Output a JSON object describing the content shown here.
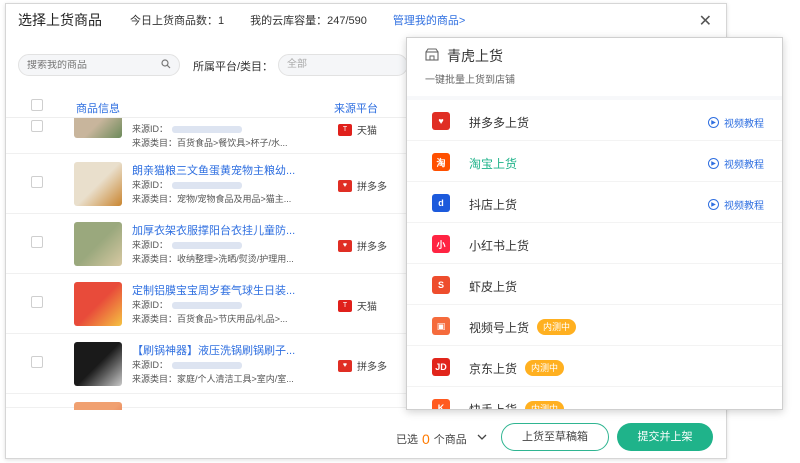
{
  "dialog": {
    "title": "选择上货商品",
    "today_label": "今日上货商品数：1",
    "capacity_label": "我的云库容量：247/590",
    "manage_link": "管理我的商品>",
    "close_glyph": "✕"
  },
  "filters": {
    "search_placeholder": "搜索我的商品",
    "platform_label": "所属平台/类目：",
    "platform_value": "全部"
  },
  "table": {
    "columns": [
      "商品信息",
      "来源平台"
    ],
    "source_prefix": "来源ID：",
    "rows": [
      {
        "title": "",
        "category": "来源类目：百货食品>餐饮具>杯子/水...",
        "platform": "天猫",
        "platform_color": "#e0201b",
        "thumb_colors": [
          "#c8b59c",
          "#6c8a5a"
        ]
      },
      {
        "title": "朗亲猫粮三文鱼蛋黄宠物主粮幼...",
        "category": "来源类目：宠物/宠物食品及用品>猫主...",
        "platform": "拼多多",
        "platform_color": "#e02e24",
        "thumb_colors": [
          "#e9dfcc",
          "#c9852f"
        ]
      },
      {
        "title": "加厚衣架衣服撑阳台衣挂儿童防...",
        "category": "来源类目：收纳整理>洗晒/熨烫/护理用...",
        "platform": "拼多多",
        "platform_color": "#e02e24",
        "thumb_colors": [
          "#9aa87d",
          "#d8c9a3"
        ]
      },
      {
        "title": "定制铝膜宝宝周岁套气球生日装...",
        "category": "来源类目：百货食品>节庆用品/礼品>...",
        "platform": "天猫",
        "platform_color": "#e0201b",
        "thumb_colors": [
          "#e84b3a",
          "#f5c342"
        ]
      },
      {
        "title": "【刷锅神器】液压洗锅刷锅刷子...",
        "category": "来源类目：家庭/个人清洁工具>室内/室...",
        "platform": "拼多多",
        "platform_color": "#e02e24",
        "thumb_colors": [
          "#1a1a1a",
          "#c9c9c9"
        ]
      },
      {
        "title": "",
        "category": "",
        "platform": "",
        "platform_color": "#e02e24",
        "thumb_colors": [
          "#f0a070",
          "#e0603a"
        ]
      }
    ]
  },
  "footer": {
    "selected_prefix": "已选",
    "selected_count": "0",
    "selected_suffix": "个商品",
    "draft_button": "上货至草稿箱",
    "submit_button": "提交并上架"
  },
  "popup": {
    "store_name": "青虎上货",
    "subtitle": "一键批量上货到店铺",
    "items": [
      {
        "label": "拼多多上货",
        "icon_color": "#e02e24",
        "icon_text": "♥",
        "video": "视频教程",
        "tag": "",
        "active": false
      },
      {
        "label": "淘宝上货",
        "icon_color": "#ff5000",
        "icon_text": "淘",
        "video": "视频教程",
        "tag": "",
        "active": true
      },
      {
        "label": "抖店上货",
        "icon_color": "#1c5adc",
        "icon_text": "d",
        "video": "视频教程",
        "tag": "",
        "active": false
      },
      {
        "label": "小红书上货",
        "icon_color": "#ff2442",
        "icon_text": "小",
        "video": "",
        "tag": "",
        "active": false
      },
      {
        "label": "虾皮上货",
        "icon_color": "#ee4d2d",
        "icon_text": "S",
        "video": "",
        "tag": "",
        "active": false
      },
      {
        "label": "视频号上货",
        "icon_color": "#f56b3c",
        "icon_text": "▣",
        "video": "",
        "tag": "内测中",
        "active": false
      },
      {
        "label": "京东上货",
        "icon_color": "#e1251b",
        "icon_text": "JD",
        "video": "",
        "tag": "内测中",
        "active": false
      },
      {
        "label": "快手上货",
        "icon_color": "#ff5a1f",
        "icon_text": "K",
        "video": "",
        "tag": "内测中",
        "active": false
      }
    ]
  },
  "colors": {
    "accent_green": "#1fb38a",
    "link_blue": "#2f6fe0",
    "tag_orange": "#ffb020"
  }
}
